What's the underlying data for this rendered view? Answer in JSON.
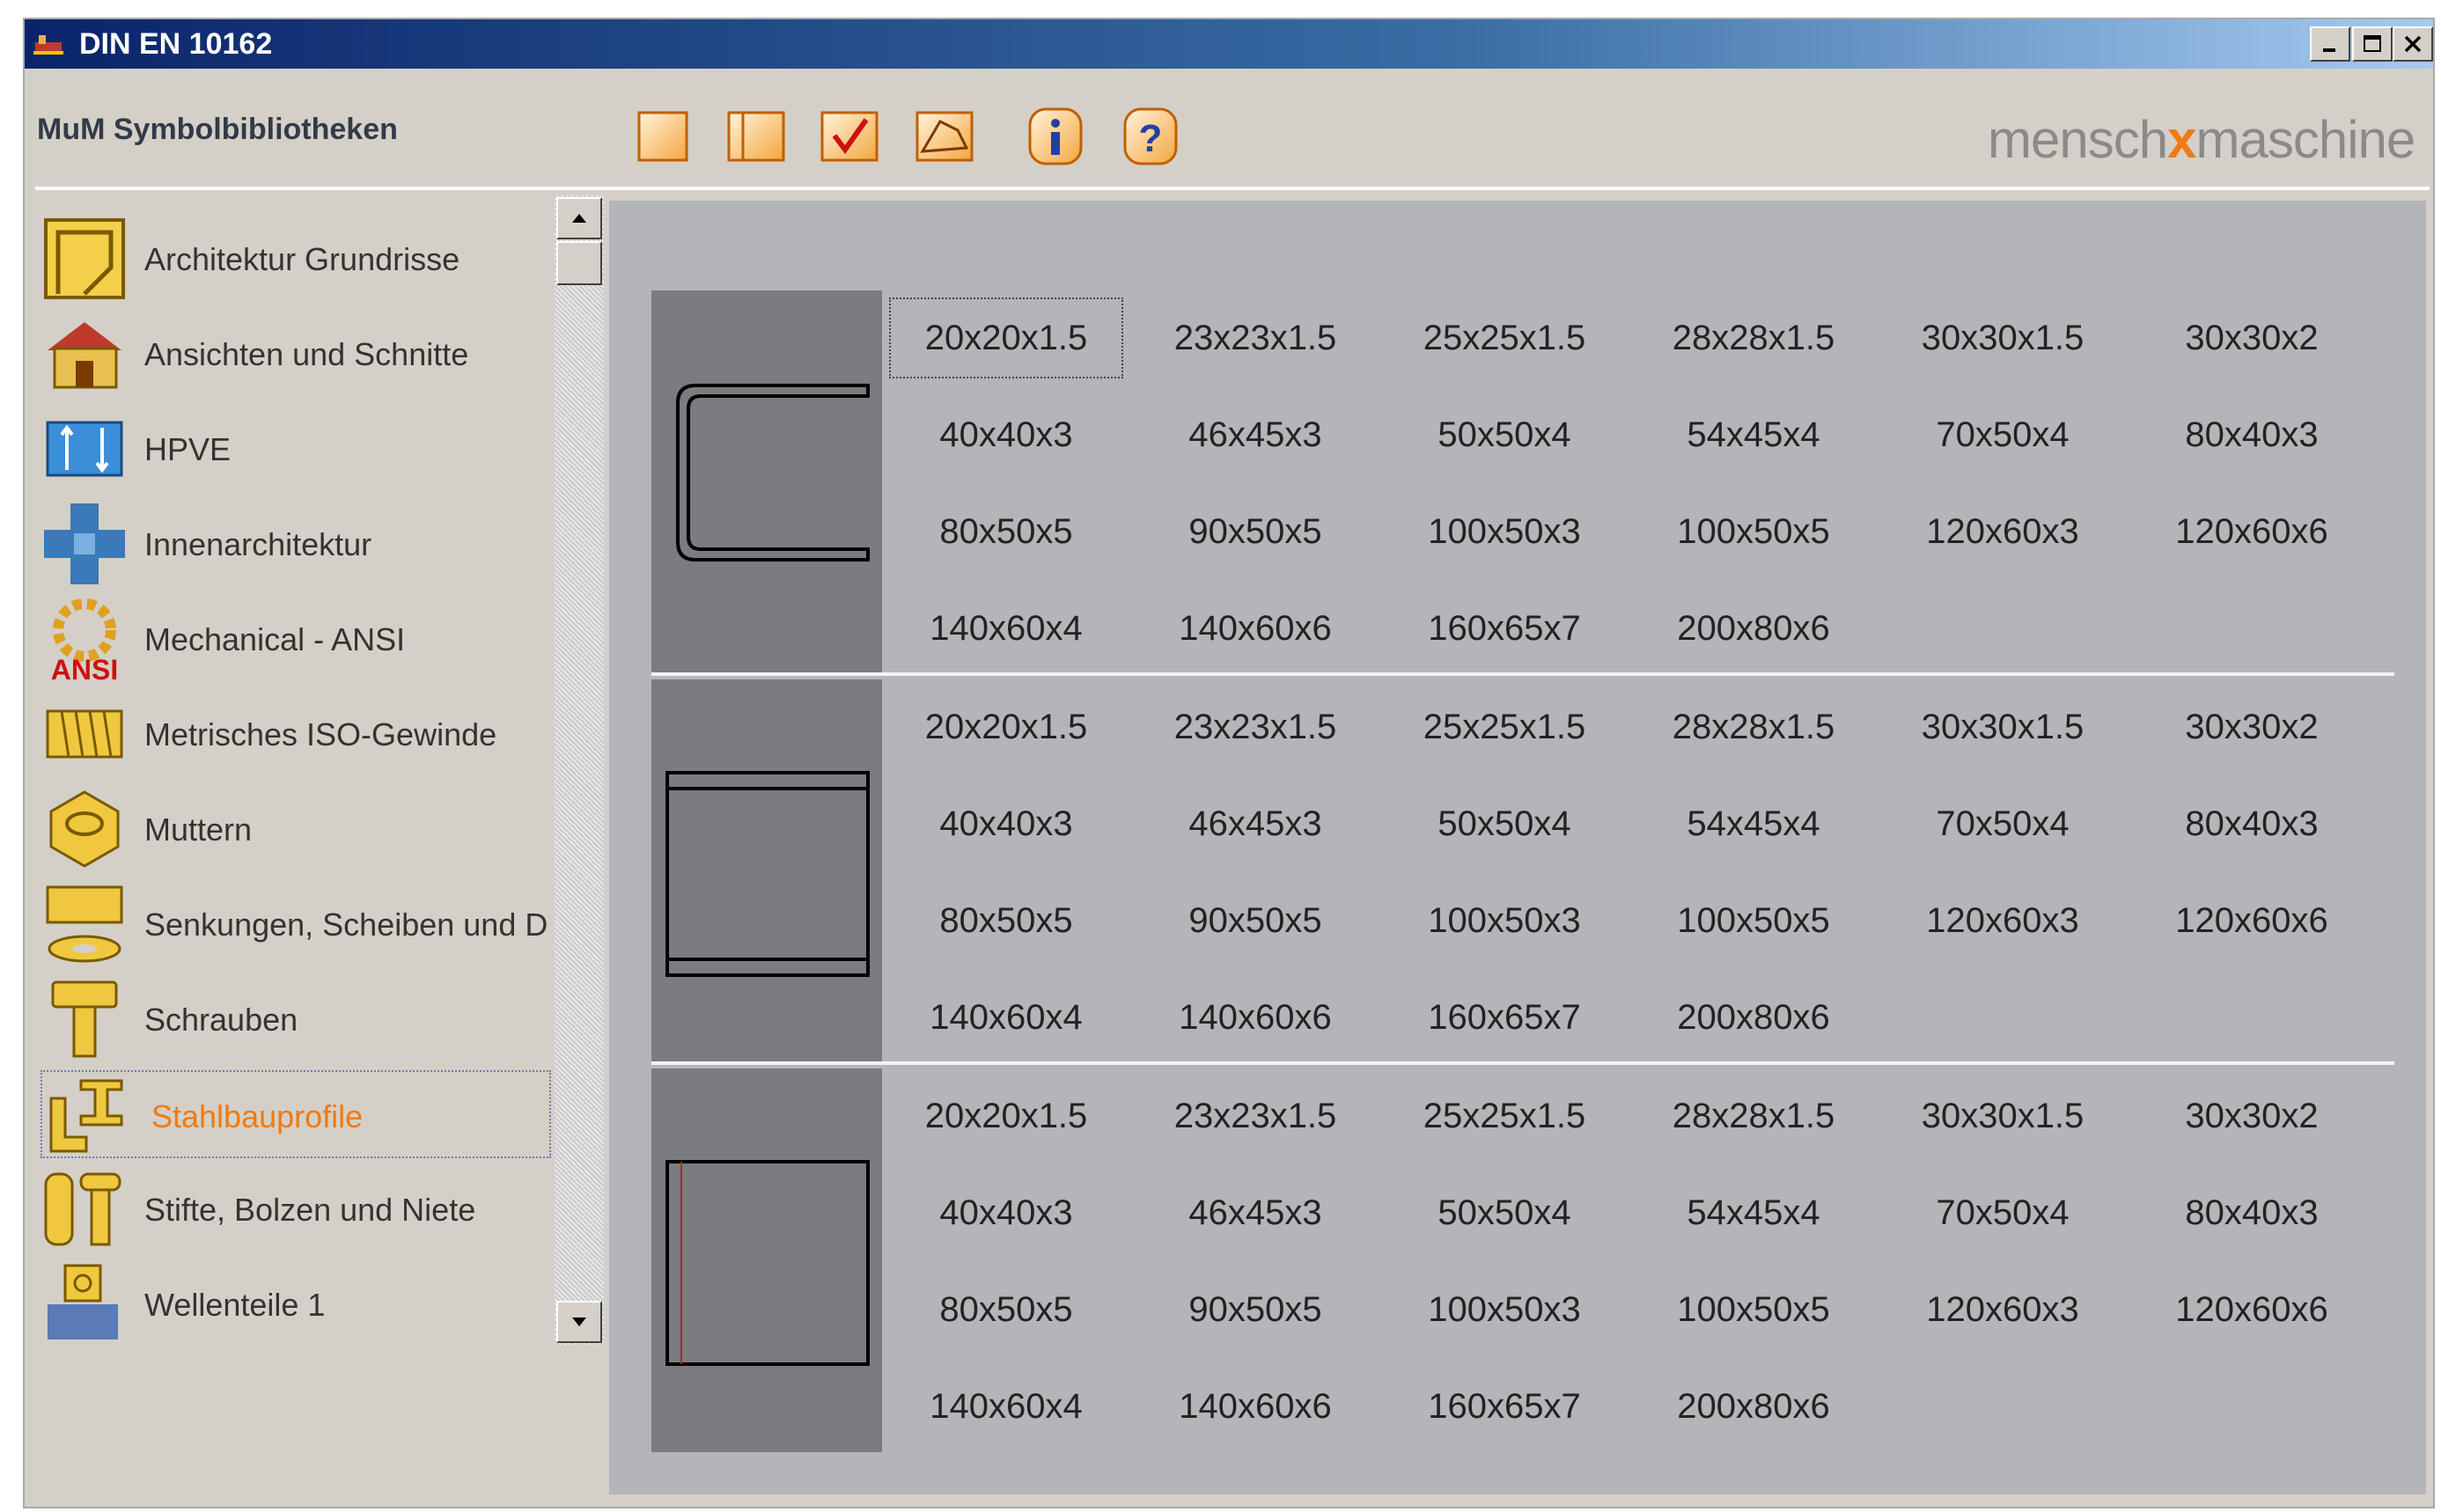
{
  "window": {
    "title": "DIN EN 10162"
  },
  "toolbar": {
    "library_title": "MuM Symbolbibliotheken",
    "brand_left": "mensch",
    "brand_mid": "x",
    "brand_right": "maschine",
    "buttons": [
      "new-doc-icon",
      "open-doc-icon",
      "check-icon",
      "insert-icon",
      "info-icon",
      "help-icon"
    ]
  },
  "sidebar": {
    "items": [
      {
        "label": "Architektur Grundrisse",
        "icon": "floorplan-icon"
      },
      {
        "label": "Ansichten und Schnitte",
        "icon": "house-icon"
      },
      {
        "label": "HPVE",
        "icon": "hpve-icon"
      },
      {
        "label": "Innenarchitektur",
        "icon": "interior-icon"
      },
      {
        "label": "Mechanical - ANSI",
        "icon": "gear-ansi-icon",
        "badge": "ANSI"
      },
      {
        "label": "Metrisches ISO-Gewinde",
        "icon": "thread-icon"
      },
      {
        "label": "Muttern",
        "icon": "nut-icon"
      },
      {
        "label": "Senkungen, Scheiben und Du",
        "icon": "washer-icon"
      },
      {
        "label": "Schrauben",
        "icon": "screw-icon"
      },
      {
        "label": "Stahlbauprofile",
        "icon": "steel-profile-icon",
        "selected": true
      },
      {
        "label": "Stifte, Bolzen und Niete",
        "icon": "pin-icon"
      },
      {
        "label": "Wellenteile 1",
        "icon": "shaft-icon"
      }
    ]
  },
  "sections": [
    {
      "profile": "c-channel",
      "rows": [
        [
          "20x20x1.5",
          "23x23x1.5",
          "25x25x1.5",
          "28x28x1.5",
          "30x30x1.5",
          "30x30x2"
        ],
        [
          "40x40x3",
          "46x45x3",
          "50x50x4",
          "54x45x4",
          "70x50x4",
          "80x40x3"
        ],
        [
          "80x50x5",
          "90x50x5",
          "100x50x3",
          "100x50x5",
          "120x60x3",
          "120x60x6"
        ],
        [
          "140x60x4",
          "140x60x6",
          "160x65x7",
          "200x80x6"
        ]
      ]
    },
    {
      "profile": "u-section",
      "rows": [
        [
          "20x20x1.5",
          "23x23x1.5",
          "25x25x1.5",
          "28x28x1.5",
          "30x30x1.5",
          "30x30x2"
        ],
        [
          "40x40x3",
          "46x45x3",
          "50x50x4",
          "54x45x4",
          "70x50x4",
          "80x40x3"
        ],
        [
          "80x50x5",
          "90x50x5",
          "100x50x3",
          "100x50x5",
          "120x60x3",
          "120x60x6"
        ],
        [
          "140x60x4",
          "140x60x6",
          "160x65x7",
          "200x80x6"
        ]
      ]
    },
    {
      "profile": "box-section",
      "rows": [
        [
          "20x20x1.5",
          "23x23x1.5",
          "25x25x1.5",
          "28x28x1.5",
          "30x30x1.5",
          "30x30x2"
        ],
        [
          "40x40x3",
          "46x45x3",
          "50x50x4",
          "54x45x4",
          "70x50x4",
          "80x40x3"
        ],
        [
          "80x50x5",
          "90x50x5",
          "100x50x3",
          "100x50x5",
          "120x60x3",
          "120x60x6"
        ],
        [
          "140x60x4",
          "140x60x6",
          "160x65x7",
          "200x80x6"
        ]
      ]
    }
  ],
  "colors": {
    "accent": "#f07a10",
    "titlebar": "#0a246a",
    "panel": "#b3b5b8"
  }
}
